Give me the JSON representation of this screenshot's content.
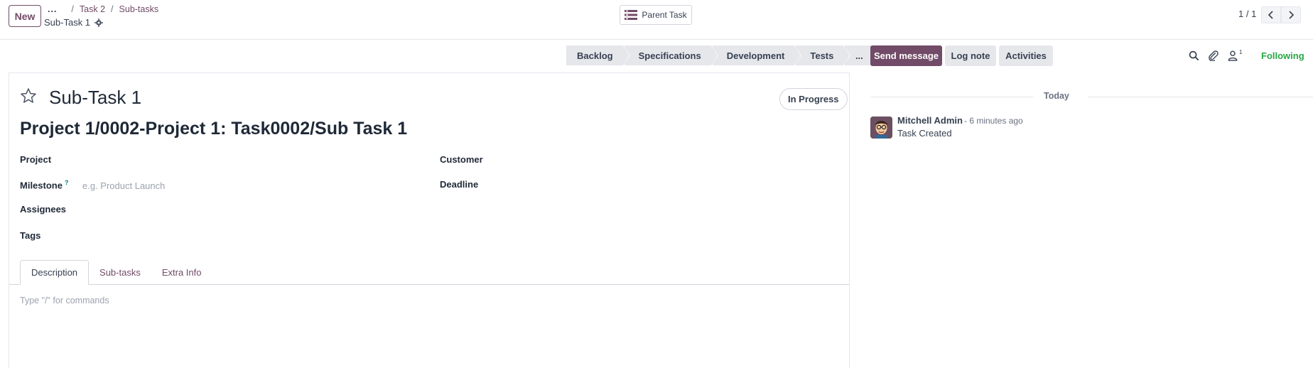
{
  "control": {
    "new_label": "New",
    "breadcrumb": {
      "ellipsis": "...",
      "items": [
        "Task 2",
        "Sub-tasks"
      ]
    },
    "record_title": "Sub-Task 1",
    "parent_task_label": "Parent Task",
    "pager": "1 / 1"
  },
  "statusbar": {
    "stages": [
      "Backlog",
      "Specifications",
      "Development",
      "Tests"
    ],
    "more": "..."
  },
  "form": {
    "task_name": "Sub-Task 1",
    "state_badge": "In Progress",
    "display_name": "Project 1/0002-Project 1: Task0002/Sub Task 1",
    "fields": {
      "project_label": "Project",
      "milestone_label": "Milestone",
      "milestone_help": "?",
      "milestone_placeholder": "e.g. Product Launch",
      "assignees_label": "Assignees",
      "tags_label": "Tags",
      "customer_label": "Customer",
      "deadline_label": "Deadline"
    },
    "tabs": [
      "Description",
      "Sub-tasks",
      "Extra Info"
    ],
    "editor_placeholder": "Type \"/\" for commands"
  },
  "chatter": {
    "send_message": "Send message",
    "log_note": "Log note",
    "activities": "Activities",
    "follower_count": "1",
    "following": "Following",
    "date_separator": "Today",
    "messages": [
      {
        "author": "Mitchell Admin",
        "time": "- 6 minutes ago",
        "body": "Task Created"
      }
    ]
  },
  "colors": {
    "brand": "#714b67",
    "following": "#28a745"
  }
}
